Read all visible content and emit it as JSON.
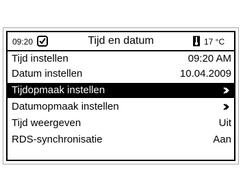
{
  "header": {
    "time": "09:20",
    "title": "Tijd en datum",
    "temperature": "17 °C",
    "status_icon": "check-icon",
    "temp_icon": "thermometer-icon"
  },
  "menu": {
    "items": [
      {
        "label": "Tijd instellen",
        "value": "09:20 AM"
      },
      {
        "label": "Datum instellen",
        "value": "10.04.2009"
      },
      {
        "label": "Tijdopmaak instellen",
        "value": "",
        "submenu": true,
        "selected": true
      },
      {
        "label": "Datumopmaak instellen",
        "value": "",
        "submenu": true
      },
      {
        "label": "Tijd weergeven",
        "value": "Uit"
      },
      {
        "label": "RDS-synchronisatie",
        "value": "Aan"
      }
    ]
  },
  "colors": {
    "selection_bg": "#000000",
    "selection_fg": "#ffffff",
    "frame": "#000000"
  }
}
